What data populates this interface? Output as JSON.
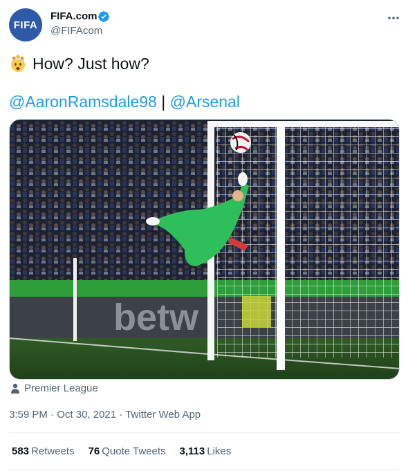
{
  "author": {
    "avatar_text": "FIFA",
    "display_name": "FIFA.com",
    "handle": "@FIFAcom",
    "verified": true
  },
  "tweet": {
    "emoji_icon": "exploding-head-emoji",
    "text": "How? Just how?",
    "mentions": [
      "@AaronRamsdale98",
      "@Arsenal"
    ],
    "mention_separator": "|"
  },
  "media": {
    "board_text": "betw"
  },
  "location": "Premier League",
  "meta": {
    "time": "3:59 PM",
    "date": "Oct 30, 2021",
    "source": "Twitter Web App"
  },
  "stats": [
    {
      "count": "583",
      "label": "Retweets"
    },
    {
      "count": "76",
      "label": "Quote Tweets"
    },
    {
      "count": "3,113",
      "label": "Likes"
    }
  ],
  "colors": {
    "link": "#1d9bf0",
    "secondary_text": "#536471",
    "avatar_bg": "#2f5aa8"
  }
}
